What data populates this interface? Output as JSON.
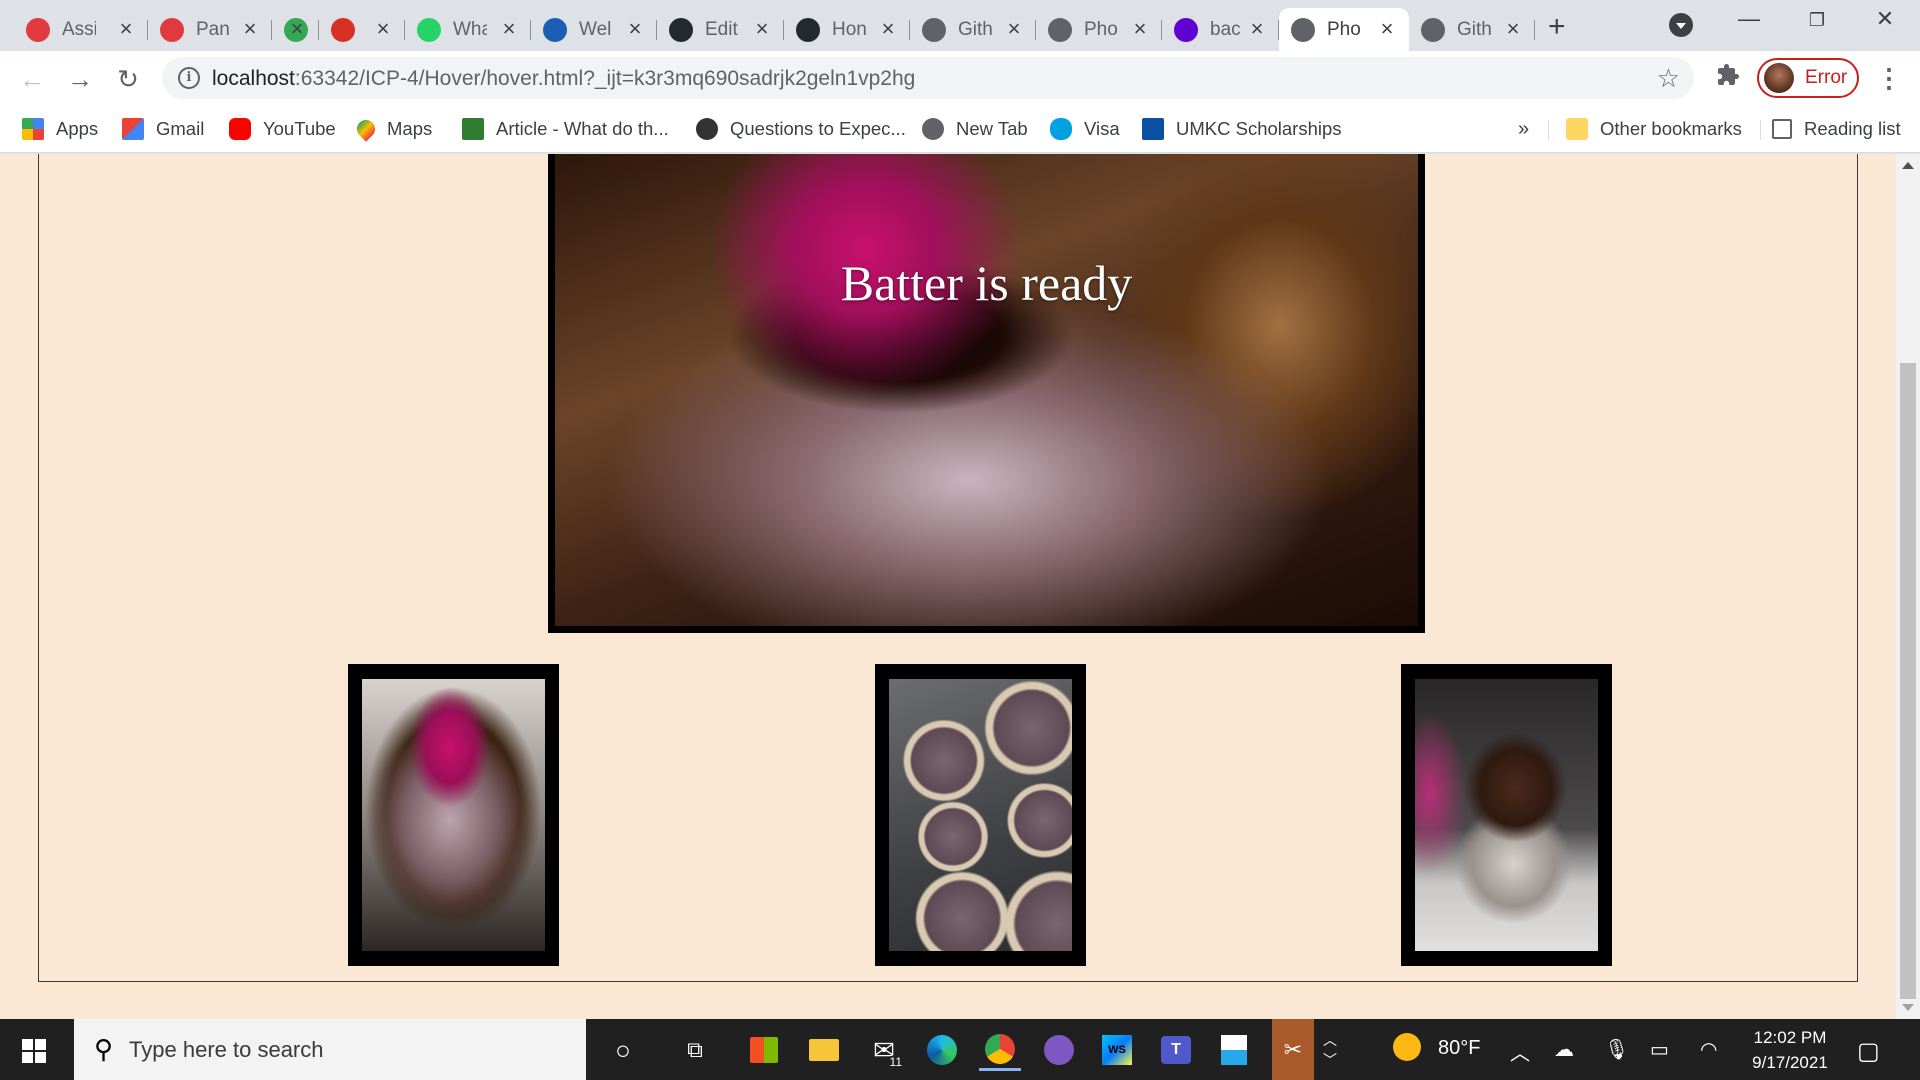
{
  "tabs": [
    {
      "title": "Assi",
      "icon": "canvas-icon",
      "color": "#e03a3e"
    },
    {
      "title": "Pan",
      "icon": "canvas-icon",
      "color": "#e03a3e"
    },
    {
      "title": "",
      "icon": "recycle-icon",
      "color": "#34a853"
    },
    {
      "title": "",
      "icon": "record-icon",
      "color": "#d93025"
    },
    {
      "title": "Wha",
      "icon": "whatsapp-icon",
      "color": "#25d366"
    },
    {
      "title": "Wel",
      "icon": "box-icon",
      "color": "#1a5fb4"
    },
    {
      "title": "Edit",
      "icon": "github-icon",
      "color": "#24292e"
    },
    {
      "title": "Hon",
      "icon": "github-icon",
      "color": "#24292e"
    },
    {
      "title": "Gith",
      "icon": "globe-icon",
      "color": "#5f6368"
    },
    {
      "title": "Pho",
      "icon": "globe-icon",
      "color": "#5f6368"
    },
    {
      "title": "bac",
      "icon": "yahoo-icon",
      "color": "#6001d2"
    },
    {
      "title": "Pho",
      "icon": "globe-icon",
      "color": "#5f6368",
      "active": true
    },
    {
      "title": "Gith",
      "icon": "globe-icon",
      "color": "#5f6368"
    }
  ],
  "address": {
    "host": "localhost",
    "rest": ":63342/ICP-4/Hover/hover.html?_ijt=k3r3mq690sadrjk2geln1vp2hg"
  },
  "profile": {
    "label": "Error"
  },
  "bookmarks": [
    {
      "label": "Apps",
      "icon": "apps-grid-icon"
    },
    {
      "label": "Gmail",
      "icon": "gmail-icon"
    },
    {
      "label": "YouTube",
      "icon": "youtube-icon"
    },
    {
      "label": "Maps",
      "icon": "maps-pin-icon"
    },
    {
      "label": "Article - What do th...",
      "icon": "article-icon"
    },
    {
      "label": "Questions to Expec...",
      "icon": "question-icon"
    },
    {
      "label": "New Tab",
      "icon": "globe-icon"
    },
    {
      "label": "Visa",
      "icon": "cloud-icon"
    },
    {
      "label": "UMKC Scholarships",
      "icon": "umkc-icon"
    }
  ],
  "bookmarks_overflow": "»",
  "other_bookmarks": "Other bookmarks",
  "reading_list": "Reading list",
  "page": {
    "hero_caption": "Batter is ready",
    "thumbnails": [
      "batter-photo",
      "cupcake-tin-photo",
      "frosted-cupcake-photo"
    ]
  },
  "taskbar": {
    "search_placeholder": "Type here to search",
    "mail_badge": "11",
    "weather": "80°F",
    "time": "12:02 PM",
    "date": "9/17/2021"
  }
}
